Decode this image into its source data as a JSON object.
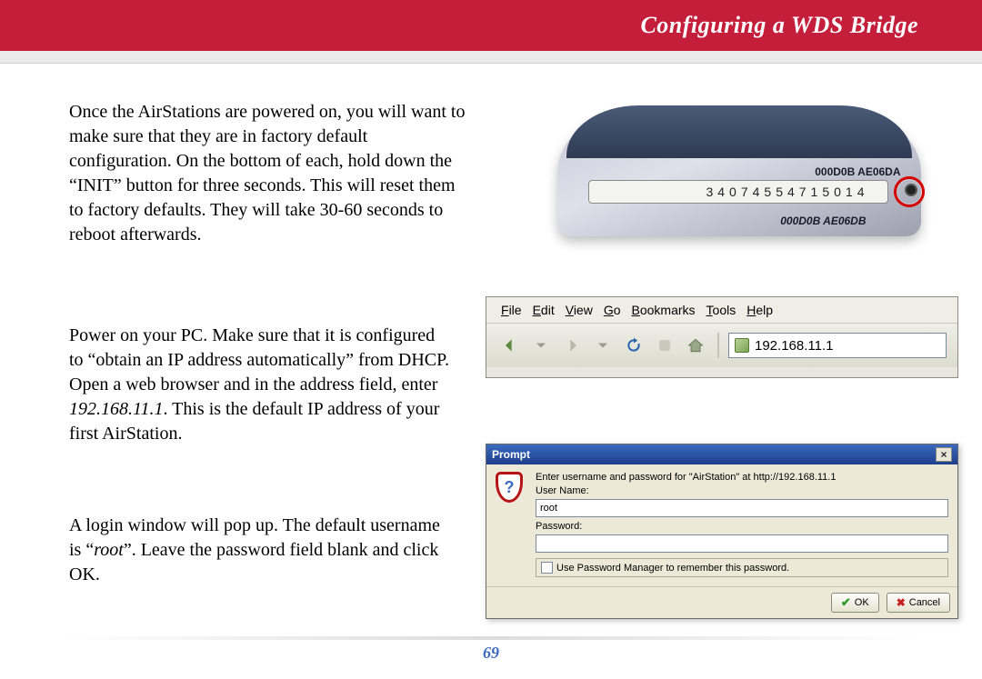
{
  "header": {
    "title": "Configuring a WDS Bridge"
  },
  "paragraphs": {
    "p1": "Once the AirStations are powered on, you will want to make sure that they are in factory default configuration.  On the bottom of each, hold down the “INIT” button for three seconds.  This will reset them to factory defaults.  They will take 30-60 seconds to reboot afterwards.",
    "p2a": "Power on your PC.  Make sure that it is configured to “obtain an IP address automatically” from DHCP.  Open a web browser and in the address field, enter ",
    "p2_ip": "192.168.11.1",
    "p2b": ".  This is the default IP address of your first AirStation.",
    "p3a": "A login window will pop up.  The default username is “",
    "p3_root": "root",
    "p3b": "”.  Leave the password field blank and click OK."
  },
  "device": {
    "mac_top": "000D0B AE06DA",
    "serial": "34074554715014",
    "mac_bottom": "000D0B AE06DB"
  },
  "browser": {
    "menu": {
      "file": "File",
      "edit": "Edit",
      "view": "View",
      "go": "Go",
      "bookmarks": "Bookmarks",
      "tools": "Tools",
      "help": "Help"
    },
    "address": "192.168.11.1"
  },
  "prompt": {
    "title": "Prompt",
    "message": "Enter username and password for \"AirStation\" at http://192.168.11.1",
    "username_label": "User Name:",
    "username_value": "root",
    "password_label": "Password:",
    "password_value": "",
    "remember": "Use Password Manager to remember this password.",
    "ok": "OK",
    "cancel": "Cancel"
  },
  "page_number": "69"
}
